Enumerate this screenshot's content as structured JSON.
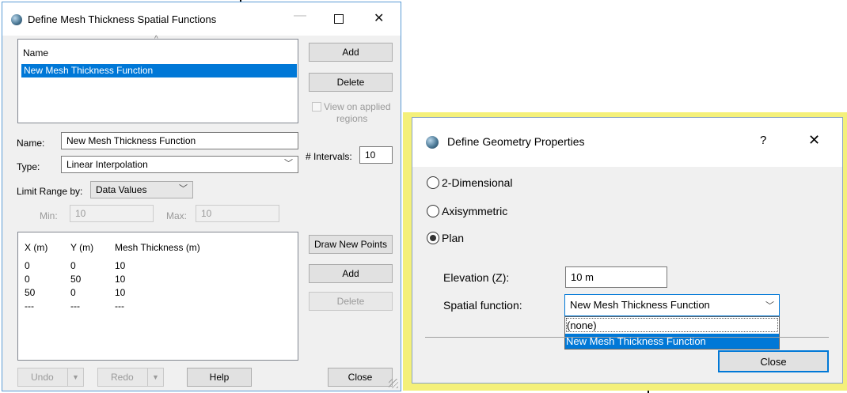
{
  "dialog1": {
    "title": "Define Mesh Thickness Spatial Functions",
    "list_header": "Name",
    "list_items": [
      "New Mesh Thickness Function"
    ],
    "add_label": "Add",
    "delete_label": "Delete",
    "view_applied_line1": "View on applied",
    "view_applied_line2": "regions",
    "name_label": "Name:",
    "name_value": "New Mesh Thickness Function",
    "type_label": "Type:",
    "type_value": "Linear Interpolation",
    "intervals_label": "# Intervals:",
    "intervals_value": "10",
    "limit_label": "Limit Range by:",
    "limit_value": "Data Values",
    "min_label": "Min:",
    "min_value": "10",
    "max_label": "Max:",
    "max_value": "10",
    "table": {
      "headers": [
        "X (m)",
        "Y (m)",
        "Mesh Thickness (m)"
      ],
      "rows": [
        [
          "0",
          "0",
          "10"
        ],
        [
          "0",
          "50",
          "10"
        ],
        [
          "50",
          "0",
          "10"
        ],
        [
          "---",
          "---",
          "---"
        ]
      ]
    },
    "draw_points_label": "Draw New Points",
    "pts_add_label": "Add",
    "pts_delete_label": "Delete",
    "undo_label": "Undo",
    "redo_label": "Redo",
    "help_label": "Help",
    "close_label": "Close"
  },
  "dialog2": {
    "title": "Define Geometry Properties",
    "help_glyph": "?",
    "close_glyph": "✕",
    "options": [
      "2-Dimensional",
      "Axisymmetric",
      "Plan"
    ],
    "selected_option": "Plan",
    "elevation_label": "Elevation (Z):",
    "elevation_value": "10 m",
    "spatial_label": "Spatial function:",
    "spatial_value": "New Mesh Thickness Function",
    "dropdown_options": [
      "(none)",
      "New Mesh Thickness Function"
    ],
    "close_label": "Close"
  },
  "colors": {
    "selection": "#0078d7",
    "highlight_border": "#f4f07a"
  }
}
